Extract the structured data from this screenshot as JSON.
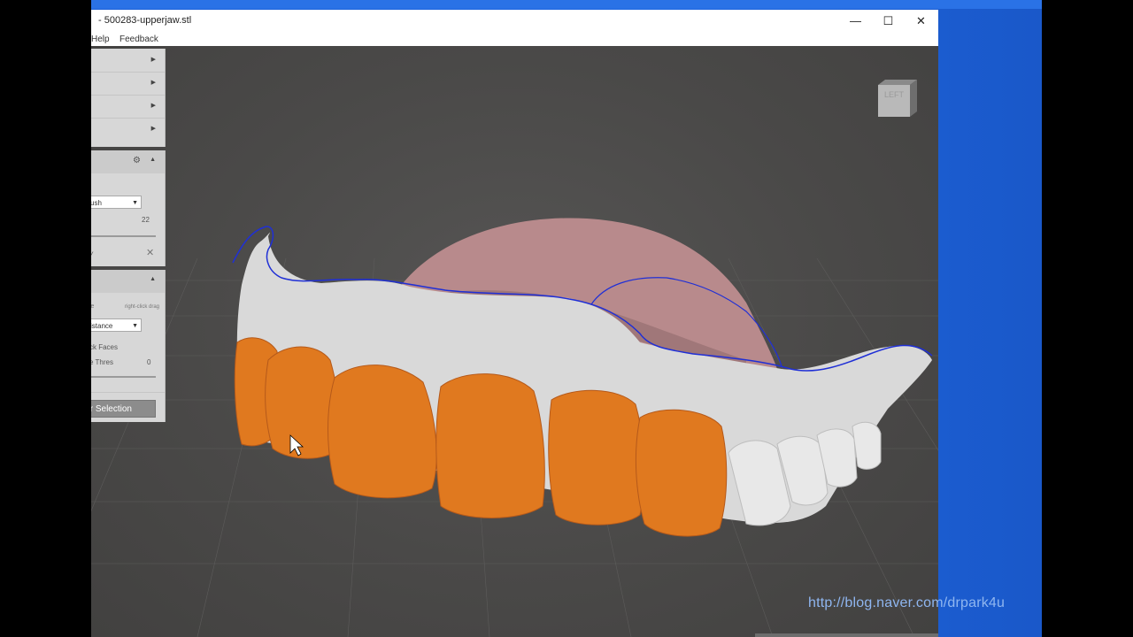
{
  "window": {
    "title": "- 500283-upperjaw.stl",
    "controls": {
      "minimize": "—",
      "maximize": "☐",
      "close": "✕"
    }
  },
  "menu": [
    {
      "label": "Help"
    },
    {
      "label": "Feedback"
    }
  ],
  "panel_top": {
    "rows": [
      {
        "arrow": "▶"
      },
      {
        "arrow": "▶"
      },
      {
        "arrow": "▶"
      },
      {
        "arrow": "▶"
      }
    ]
  },
  "panel_brush": {
    "mode_dropdown": "ush",
    "size_value": "22",
    "small_label": "y"
  },
  "panel_select": {
    "hint_left": "le",
    "hint_right": "right-click drag",
    "distance_dropdown": "istance",
    "option_label": "ck Faces",
    "threshold_label": "e Thres",
    "threshold_value": "0",
    "selection_button": "r Selection"
  },
  "viewcube": {
    "label": "LEFT"
  },
  "watermark": "http://blog.naver.com/drpark4u",
  "colors": {
    "teeth": "#e0791f",
    "gum": "#d9d9d9",
    "palate": "#b88a8c",
    "boundary": "#1f2fd6",
    "desktop": "#1e66e0"
  }
}
